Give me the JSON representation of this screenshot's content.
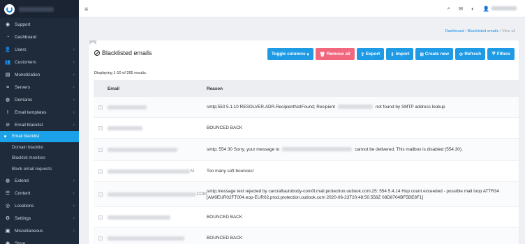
{
  "sidebar": {
    "items": [
      {
        "label": "Support",
        "icon": "support-icon",
        "glyph": "◉",
        "chevron": false
      },
      {
        "label": "Dashboard",
        "icon": "dashboard-icon",
        "glyph": "◔",
        "chevron": false
      },
      {
        "label": "Users",
        "icon": "users-icon",
        "glyph": "👤",
        "chevron": true
      },
      {
        "label": "Customers",
        "icon": "customers-icon",
        "glyph": "👥",
        "chevron": true
      },
      {
        "label": "Monetization",
        "icon": "monetization-icon",
        "glyph": "▤",
        "chevron": true
      },
      {
        "label": "Servers",
        "icon": "servers-icon",
        "glyph": "≡",
        "chevron": true
      },
      {
        "label": "Domains",
        "icon": "domains-icon",
        "glyph": "◍",
        "chevron": true
      },
      {
        "label": "Email templates",
        "icon": "email-templates-icon",
        "glyph": "I",
        "chevron": true
      },
      {
        "label": "Email blacklist",
        "icon": "ban-icon",
        "glyph": "⊘",
        "chevron": true
      }
    ],
    "sub_items": [
      {
        "label": "Email blacklist",
        "active": true
      },
      {
        "label": "Domain blacklist",
        "active": false
      },
      {
        "label": "Blacklist monitors",
        "active": false
      },
      {
        "label": "Block email requests",
        "active": false
      }
    ],
    "items_after": [
      {
        "label": "Extend",
        "icon": "extend-icon",
        "glyph": "◍",
        "chevron": true
      },
      {
        "label": "Content",
        "icon": "content-icon",
        "glyph": "☰",
        "chevron": true
      },
      {
        "label": "Locations",
        "icon": "locations-icon",
        "glyph": "◎",
        "chevron": true
      },
      {
        "label": "Settings",
        "icon": "settings-icon",
        "glyph": "⚙",
        "chevron": true
      },
      {
        "label": "Miscellaneous",
        "icon": "miscellaneous-icon",
        "glyph": "▣",
        "chevron": true
      },
      {
        "label": "Store",
        "icon": "store-icon",
        "glyph": "◉",
        "chevron": false
      }
    ]
  },
  "topbar": {
    "menu_glyph": "≡",
    "search_glyph": "⌕",
    "mail_glyph": "✉",
    "contrast_glyph": "◐",
    "user_glyph": "👤"
  },
  "breadcrumb": {
    "home": "Dashboard",
    "parent": "Blacklisted emails",
    "current": "View all",
    "sep": "/"
  },
  "page": {
    "title": "Blacklisted emails",
    "summary": "Displaying 1-10 of 265 results."
  },
  "toolbar": [
    {
      "label": "Toggle columns",
      "suffix": " ▾",
      "glyph": "",
      "style": "primary"
    },
    {
      "label": "Remove all",
      "suffix": "",
      "glyph": "🗑",
      "style": "danger"
    },
    {
      "label": "Export",
      "suffix": "",
      "glyph": "⇪",
      "style": "primary"
    },
    {
      "label": "Import",
      "suffix": "",
      "glyph": "⇩",
      "style": "primary"
    },
    {
      "label": "Create new",
      "suffix": "",
      "glyph": "⊞",
      "style": "primary"
    },
    {
      "label": "Refresh",
      "suffix": "",
      "glyph": "⟳",
      "style": "primary"
    },
    {
      "label": "Filters",
      "suffix": "",
      "glyph": "⧩",
      "style": "primary"
    }
  ],
  "table": {
    "columns": [
      "Email",
      "Reason"
    ],
    "rows": [
      {
        "email_tail": "",
        "reason_before": "smtp;550 5.1.10 RESOLVER.ADR.RecipientNotFound; Recipient",
        "reason_after": "not found by SMTP address lookup",
        "blur": "short",
        "blur_width": 56
      },
      {
        "email_tail": "",
        "reason_before": "BOUNCED BACK",
        "reason_after": "",
        "blur": "",
        "blur_width": 50
      },
      {
        "email_tail": "",
        "reason_before": "smtp; 554 30 Sorry, your message to",
        "reason_after": "cannot be delivered. This mailbox is disabled (554.30).",
        "blur": "long",
        "blur_width": 100
      },
      {
        "email_tail": "M",
        "reason_before": "Too many soft bounces!",
        "reason_after": "",
        "blur": "",
        "blur_width": 118
      },
      {
        "email_tail": "COM",
        "reason_before": "smtp;message text rejected by carcraftautobody-com0l.mail.protection.outlook.com:25: 554 5.4.14 Hop count exceeded - possible mail loop ATTR34 [AM0EUR02FT004.eop-EUR02.prod.protection.outlook.com 2020-06-23T20:48:50.558Z 08D8704BF5BE8F1]",
        "reason_after": "",
        "blur": "",
        "blur_width": 128
      },
      {
        "email_tail": "",
        "reason_before": "BOUNCED BACK",
        "reason_after": "",
        "blur": "",
        "blur_width": 90
      },
      {
        "email_tail": "",
        "reason_before": "BOUNCED BACK",
        "reason_after": "",
        "blur": "",
        "blur_width": 110
      }
    ]
  }
}
